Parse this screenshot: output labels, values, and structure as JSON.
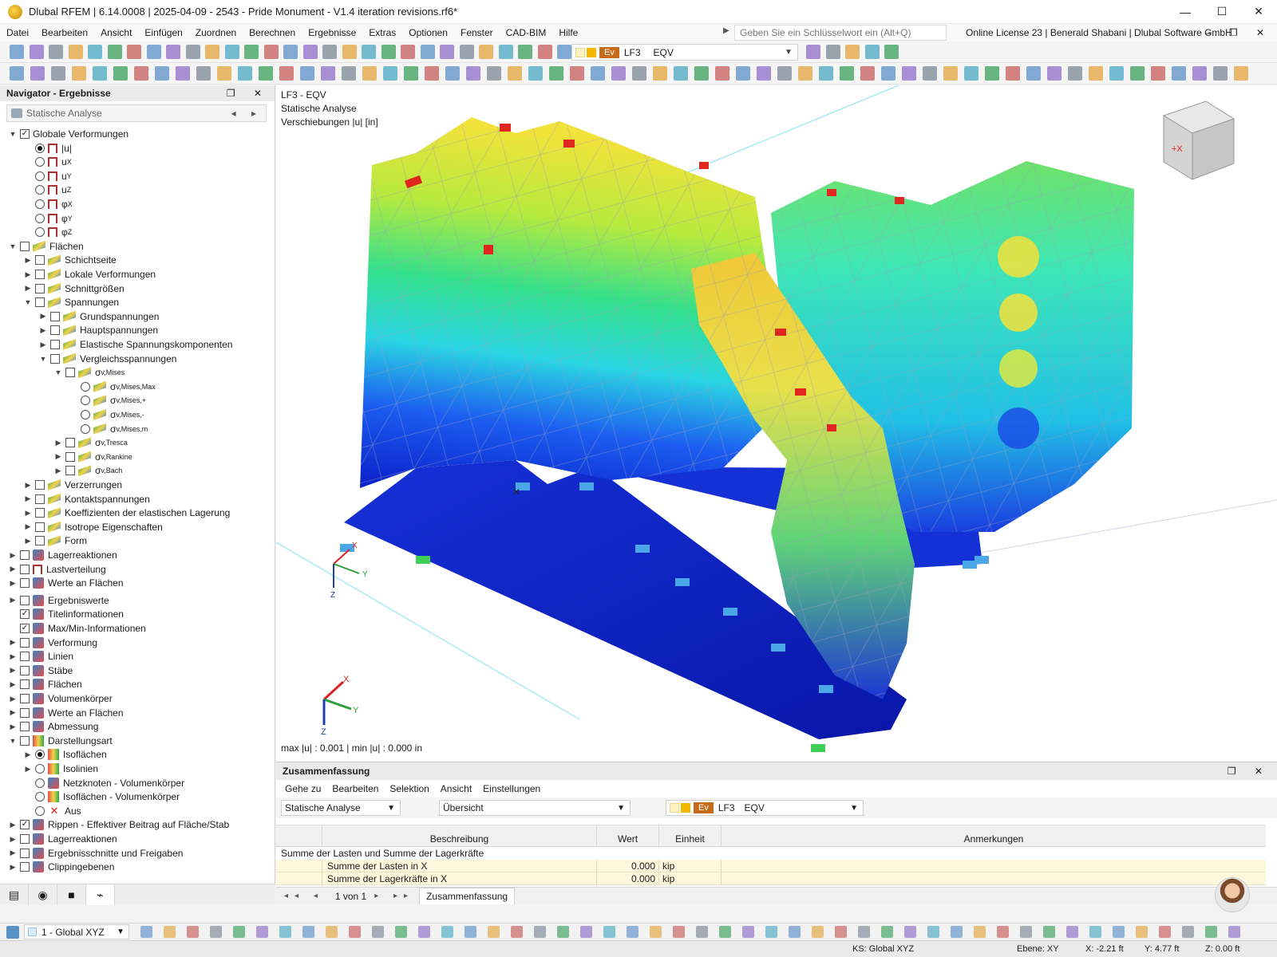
{
  "window": {
    "title": "Dlubal RFEM | 6.14.0008 | 2025-04-09 - 2543 - Pride Monument - V1.4 iteration revisions.rf6*",
    "minimize": "—",
    "maximize": "☐",
    "close": "✕"
  },
  "menu": {
    "items": [
      "Datei",
      "Bearbeiten",
      "Ansicht",
      "Einfügen",
      "Zuordnen",
      "Berechnen",
      "Ergebnisse",
      "Extras",
      "Optionen",
      "Fenster",
      "CAD-BIM",
      "Hilfe"
    ],
    "search_placeholder": "Geben Sie ein Schlüsselwort ein (Alt+Q)",
    "license": "Online License 23 | Benerald Shabani | Dlubal Software GmbH",
    "mdi_buttons": "– ❐ ✕"
  },
  "toolbar": {
    "loadcase": {
      "tag": "Ev",
      "case": "LF3",
      "combo": "EQV"
    }
  },
  "navigator": {
    "title": "Navigator - Ergebnisse",
    "header_buttons": "❐ ✕",
    "combo": "Statische Analyse",
    "combo_arrows": "◂ ▸",
    "tree": [
      {
        "level": 0,
        "exp": "v",
        "ctrl": "check",
        "checked": true,
        "icon": "none",
        "label": "Globale Verformungen"
      },
      {
        "level": 1,
        "exp": "",
        "ctrl": "radio",
        "checked": true,
        "icon": "defo",
        "label": "|u|"
      },
      {
        "level": 1,
        "exp": "",
        "ctrl": "radio",
        "checked": false,
        "icon": "defo",
        "label": "u",
        "sub": "X"
      },
      {
        "level": 1,
        "exp": "",
        "ctrl": "radio",
        "checked": false,
        "icon": "defo",
        "label": "u",
        "sub": "Y"
      },
      {
        "level": 1,
        "exp": "",
        "ctrl": "radio",
        "checked": false,
        "icon": "defo",
        "label": "u",
        "sub": "Z"
      },
      {
        "level": 1,
        "exp": "",
        "ctrl": "radio",
        "checked": false,
        "icon": "defo",
        "label": "φ",
        "sub": "X"
      },
      {
        "level": 1,
        "exp": "",
        "ctrl": "radio",
        "checked": false,
        "icon": "defo",
        "label": "φ",
        "sub": "Y"
      },
      {
        "level": 1,
        "exp": "",
        "ctrl": "radio",
        "checked": false,
        "icon": "defo",
        "label": "φ",
        "sub": "Z"
      },
      {
        "level": 0,
        "exp": "v",
        "ctrl": "check",
        "checked": false,
        "icon": "surf",
        "label": "Flächen"
      },
      {
        "level": 1,
        "exp": ">",
        "ctrl": "check",
        "checked": false,
        "icon": "surf",
        "label": "Schichtseite"
      },
      {
        "level": 1,
        "exp": ">",
        "ctrl": "check",
        "checked": false,
        "icon": "surf",
        "label": "Lokale Verformungen"
      },
      {
        "level": 1,
        "exp": ">",
        "ctrl": "check",
        "checked": false,
        "icon": "surf",
        "label": "Schnittgrößen"
      },
      {
        "level": 1,
        "exp": "v",
        "ctrl": "check",
        "checked": false,
        "icon": "surf",
        "label": "Spannungen"
      },
      {
        "level": 2,
        "exp": ">",
        "ctrl": "check",
        "checked": false,
        "icon": "surf",
        "label": "Grundspannungen"
      },
      {
        "level": 2,
        "exp": ">",
        "ctrl": "check",
        "checked": false,
        "icon": "surf",
        "label": "Hauptspannungen"
      },
      {
        "level": 2,
        "exp": ">",
        "ctrl": "check",
        "checked": false,
        "icon": "surf",
        "label": "Elastische Spannungskomponenten"
      },
      {
        "level": 2,
        "exp": "v",
        "ctrl": "check",
        "checked": false,
        "icon": "surf",
        "label": "Vergleichsspannungen"
      },
      {
        "level": 3,
        "exp": "v",
        "ctrl": "check",
        "checked": false,
        "icon": "surf",
        "label": "σ",
        "sub": "v,Mises"
      },
      {
        "level": 4,
        "exp": "",
        "ctrl": "radio",
        "checked": false,
        "icon": "surf",
        "label": "σ",
        "sub": "v,Mises,Max"
      },
      {
        "level": 4,
        "exp": "",
        "ctrl": "radio",
        "checked": false,
        "icon": "surf",
        "label": "σ",
        "sub": "v,Mises,+"
      },
      {
        "level": 4,
        "exp": "",
        "ctrl": "radio",
        "checked": false,
        "icon": "surf",
        "label": "σ",
        "sub": "v,Mises,-"
      },
      {
        "level": 4,
        "exp": "",
        "ctrl": "radio",
        "checked": false,
        "icon": "surf",
        "label": "σ",
        "sub": "v,Mises,m"
      },
      {
        "level": 3,
        "exp": ">",
        "ctrl": "check",
        "checked": false,
        "icon": "surf",
        "label": "σ",
        "sub": "v,Tresca"
      },
      {
        "level": 3,
        "exp": ">",
        "ctrl": "check",
        "checked": false,
        "icon": "surf",
        "label": "σ",
        "sub": "v,Rankine"
      },
      {
        "level": 3,
        "exp": ">",
        "ctrl": "check",
        "checked": false,
        "icon": "surf",
        "label": "σ",
        "sub": "v,Bach"
      },
      {
        "level": 1,
        "exp": ">",
        "ctrl": "check",
        "checked": false,
        "icon": "surf",
        "label": "Verzerrungen"
      },
      {
        "level": 1,
        "exp": ">",
        "ctrl": "check",
        "checked": false,
        "icon": "surf",
        "label": "Kontaktspannungen"
      },
      {
        "level": 1,
        "exp": ">",
        "ctrl": "check",
        "checked": false,
        "icon": "surf",
        "label": "Koeffizienten der elastischen Lagerung"
      },
      {
        "level": 1,
        "exp": ">",
        "ctrl": "check",
        "checked": false,
        "icon": "surf",
        "label": "Isotrope Eigenschaften"
      },
      {
        "level": 1,
        "exp": ">",
        "ctrl": "check",
        "checked": false,
        "icon": "surf",
        "label": "Form"
      },
      {
        "level": 0,
        "exp": ">",
        "ctrl": "check",
        "checked": false,
        "icon": "other",
        "label": "Lagerreaktionen"
      },
      {
        "level": 0,
        "exp": ">",
        "ctrl": "check",
        "checked": false,
        "icon": "defo",
        "label": "Lastverteilung"
      },
      {
        "level": 0,
        "exp": ">",
        "ctrl": "check",
        "checked": false,
        "icon": "other",
        "label": "Werte an Flächen"
      },
      {
        "level": 0,
        "exp": ">",
        "ctrl": "check",
        "checked": false,
        "icon": "other",
        "label": "Ergebniswerte",
        "gap": true
      },
      {
        "level": 0,
        "exp": "",
        "ctrl": "check",
        "checked": true,
        "icon": "other",
        "label": "Titelinformationen"
      },
      {
        "level": 0,
        "exp": "",
        "ctrl": "check",
        "checked": true,
        "icon": "other",
        "label": "Max/Min-Informationen"
      },
      {
        "level": 0,
        "exp": ">",
        "ctrl": "check",
        "checked": false,
        "icon": "other",
        "label": "Verformung"
      },
      {
        "level": 0,
        "exp": ">",
        "ctrl": "check",
        "checked": false,
        "icon": "other",
        "label": "Linien"
      },
      {
        "level": 0,
        "exp": ">",
        "ctrl": "check",
        "checked": false,
        "icon": "other",
        "label": "Stäbe"
      },
      {
        "level": 0,
        "exp": ">",
        "ctrl": "check",
        "checked": false,
        "icon": "other",
        "label": "Flächen"
      },
      {
        "level": 0,
        "exp": ">",
        "ctrl": "check",
        "checked": false,
        "icon": "other",
        "label": "Volumenkörper"
      },
      {
        "level": 0,
        "exp": ">",
        "ctrl": "check",
        "checked": false,
        "icon": "other",
        "label": "Werte an Flächen"
      },
      {
        "level": 0,
        "exp": ">",
        "ctrl": "check",
        "checked": false,
        "icon": "other",
        "label": "Abmessung"
      },
      {
        "level": 0,
        "exp": "v",
        "ctrl": "check",
        "checked": false,
        "icon": "iso",
        "label": "Darstellungsart"
      },
      {
        "level": 1,
        "exp": ">",
        "ctrl": "radio",
        "checked": true,
        "icon": "iso",
        "label": "Isoflächen"
      },
      {
        "level": 1,
        "exp": ">",
        "ctrl": "radio",
        "checked": false,
        "icon": "iso",
        "label": "Isolinien"
      },
      {
        "level": 1,
        "exp": "",
        "ctrl": "radio",
        "checked": false,
        "icon": "other",
        "label": "Netzknoten - Volumenkörper"
      },
      {
        "level": 1,
        "exp": "",
        "ctrl": "radio",
        "checked": false,
        "icon": "iso",
        "label": "Isoflächen - Volumenkörper"
      },
      {
        "level": 1,
        "exp": "",
        "ctrl": "radio",
        "checked": false,
        "icon": "xred",
        "label": "Aus"
      },
      {
        "level": 0,
        "exp": ">",
        "ctrl": "check",
        "checked": true,
        "icon": "other",
        "label": "Rippen - Effektiver Beitrag auf Fläche/Stab"
      },
      {
        "level": 0,
        "exp": ">",
        "ctrl": "check",
        "checked": false,
        "icon": "other",
        "label": "Lagerreaktionen"
      },
      {
        "level": 0,
        "exp": ">",
        "ctrl": "check",
        "checked": false,
        "icon": "other",
        "label": "Ergebnisschnitte und Freigaben"
      },
      {
        "level": 0,
        "exp": ">",
        "ctrl": "check",
        "checked": false,
        "icon": "other",
        "label": "Clippingebenen"
      }
    ]
  },
  "viewport": {
    "info_line1": "LF3 - EQV",
    "info_line2": "Statische Analyse",
    "info_line3": "Verschiebungen |u| [in]",
    "maxmin": "max |u| : 0.001 | min |u| : 0.000 in",
    "axis_x": "X",
    "axis_y": "Y",
    "axis_z": "Z",
    "cube_label": "+X"
  },
  "summary": {
    "title": "Zusammenfassung",
    "header_buttons": "❐ ✕",
    "menu": [
      "Gehe zu",
      "Bearbeiten",
      "Selektion",
      "Ansicht",
      "Einstellungen"
    ],
    "combo_analysis": "Statische Analyse",
    "combo_view": "Übersicht",
    "lc_tag": "Ev",
    "lc_case": "LF3",
    "lc_combo": "EQV",
    "columns": [
      "Beschreibung",
      "Wert",
      "Einheit",
      "Anmerkungen"
    ],
    "group": "Summe der Lasten und Summe der Lagerkräfte",
    "rows": [
      {
        "desc": "Summe der Lasten in X",
        "value": "0.000",
        "unit": "kip",
        "note": ""
      },
      {
        "desc": "Summe der Lagerkräfte in X",
        "value": "0.000",
        "unit": "kip",
        "note": ""
      }
    ],
    "pager_prev": "◂◂ ◂",
    "pager_text": "1 von 1",
    "pager_next": "▸ ▸▸",
    "tab": "Zusammenfassung"
  },
  "bottom": {
    "view_select": "1 - Global XYZ"
  },
  "status": {
    "ks": "KS: Global XYZ",
    "plane": "Ebene: XY",
    "x": "X: -2.21 ft",
    "y": "Y: 4.77 ft",
    "z": "Z: 0.00 ft"
  },
  "colors": {
    "accent": "#2c7be5",
    "result_low": "#0a1fc8",
    "result_mid": "#28e07a",
    "result_high": "#f5e23a",
    "result_max": "#e0271f"
  }
}
